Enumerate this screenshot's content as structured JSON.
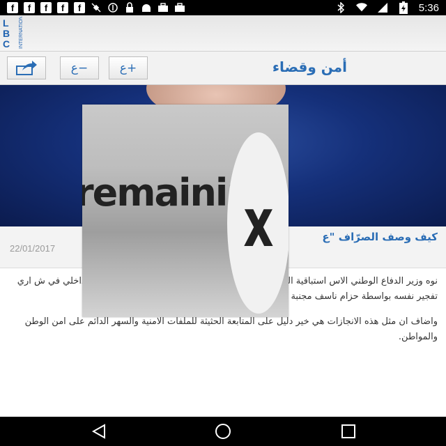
{
  "status_bar": {
    "time": "5:36",
    "left_icons": [
      "facebook-icon",
      "facebook-icon",
      "facebook-icon",
      "facebook-icon",
      "facebook-icon",
      "satellite-icon",
      "signal-blocked-icon",
      "lock-icon",
      "android-icon",
      "briefcase-icon",
      "briefcase-icon"
    ],
    "right_icons": [
      "bluetooth-icon",
      "wifi-icon",
      "cellular-icon",
      "battery-icon"
    ]
  },
  "app": {
    "logo_text": "LBC",
    "logo_subtext": "INTERNATIONAL"
  },
  "toolbar": {
    "section_title": "أمن وقضاء",
    "font_increase_label": "ع+",
    "font_decrease_label": "ع−",
    "share_icon": "share-icon"
  },
  "article": {
    "headline": "كيف وصف الصرّاف \"ع",
    "date": "22/01/2017",
    "paragraph_1": "نوه وزير الدفاع الوطني الاس                              استباقية النوعية التي نفذتها مديرية ا                              المعلومات في قوى الامن الداخلي في ش                              اري تفجير نفسه بواسطة حزام ناسف مجنبة لبنان مجزرة محتمة.",
    "paragraph_2": "واضاف ان مثل هذه الانجازات هي خير دليل على المتابعة الحثيثة للملفات الامنية والسهر الدائم على امن الوطن والمواطن."
  },
  "overlay_ad": {
    "text": "remaining",
    "close_glyph": "x"
  },
  "colors": {
    "accent": "#2a6db5",
    "logo_blue": "#1f62b0",
    "hero_blue": "#15307a"
  }
}
